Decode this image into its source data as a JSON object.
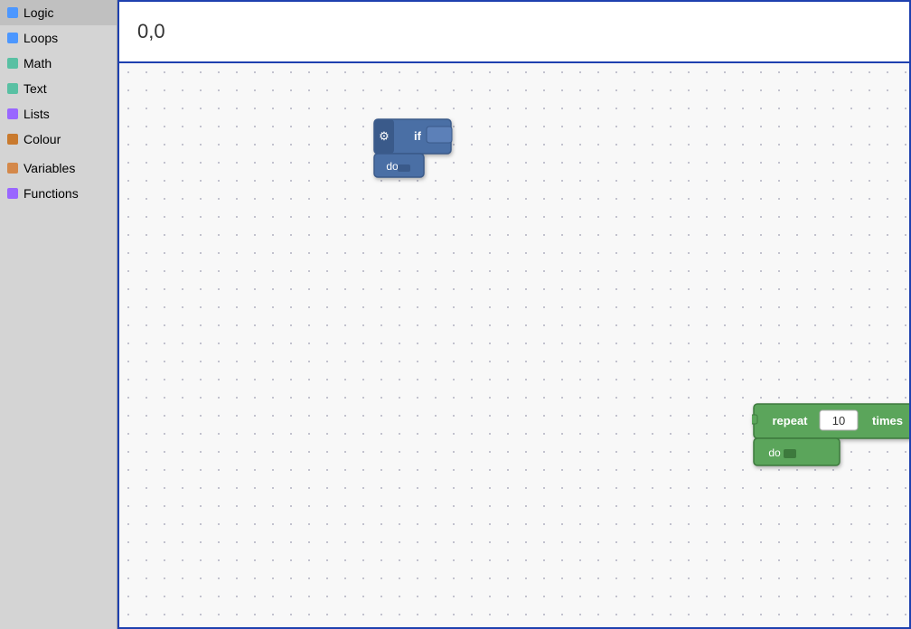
{
  "sidebar": {
    "items": [
      {
        "label": "Logic",
        "color": "#4c97ff",
        "id": "logic"
      },
      {
        "label": "Loops",
        "color": "#4c97ff",
        "id": "loops"
      },
      {
        "label": "Math",
        "color": "#59c0a3",
        "id": "math"
      },
      {
        "label": "Text",
        "color": "#59c0a3",
        "id": "text"
      },
      {
        "label": "Lists",
        "color": "#9966ff",
        "id": "lists"
      },
      {
        "label": "Colour",
        "color": "#c97a2e",
        "id": "colour"
      },
      {
        "label": "Variables",
        "color": "#c97a2e",
        "id": "variables"
      },
      {
        "label": "Functions",
        "color": "#9966ff",
        "id": "functions"
      }
    ]
  },
  "coord": "0,0",
  "if_block": {
    "label_if": "if",
    "label_do": "do"
  },
  "repeat_block": {
    "label_repeat": "repeat",
    "label_times": "times",
    "label_do": "do",
    "value": "10"
  },
  "sidebar_colors": {
    "logic": "#4c97ff",
    "loops": "#4c97ff",
    "math": "#59c0a3",
    "text": "#59c0a3",
    "lists": "#9966ff",
    "colour": "#c97a2e",
    "variables_stripe": "#d4884a",
    "functions_stripe": "#9966ff"
  }
}
